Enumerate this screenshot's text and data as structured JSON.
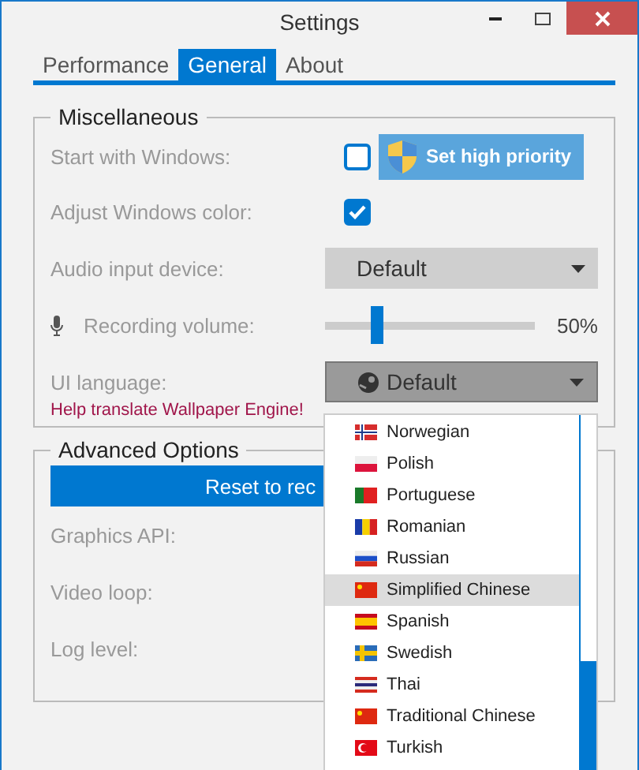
{
  "window": {
    "title": "Settings"
  },
  "tabs": [
    {
      "label": "Performance",
      "selected": false
    },
    {
      "label": "General",
      "selected": true
    },
    {
      "label": "About",
      "selected": false
    }
  ],
  "miscellaneous": {
    "title": "Miscellaneous",
    "start_with_windows": {
      "label": "Start with Windows:",
      "checked": false,
      "button": "Set high priority"
    },
    "adjust_windows_color": {
      "label": "Adjust Windows color:",
      "checked": true
    },
    "audio_input_device": {
      "label": "Audio input device:",
      "value": "Default"
    },
    "recording_volume": {
      "label": "Recording volume:",
      "level": 0.25,
      "reading": "50%"
    },
    "ui_language": {
      "label": "UI language:",
      "value": "Default",
      "expanded": true,
      "help_link": "Help translate Wallpaper Engine!"
    }
  },
  "advanced_options": {
    "title": "Advanced Options",
    "reset_button": "Reset to rec",
    "rows": [
      {
        "label": "Graphics API:"
      },
      {
        "label": "Video loop:"
      },
      {
        "label": "Log level:"
      }
    ]
  },
  "language_menu": [
    {
      "label": "Norwegian",
      "selected": false,
      "kind": "norway"
    },
    {
      "label": "Polish",
      "selected": false,
      "kind": "poland"
    },
    {
      "label": "Portuguese",
      "selected": false,
      "kind": "portugal"
    },
    {
      "label": "Romanian",
      "selected": false,
      "kind": "romania"
    },
    {
      "label": "Russian",
      "selected": false,
      "kind": "russia"
    },
    {
      "label": "Simplified Chinese",
      "selected": true,
      "kind": "china"
    },
    {
      "label": "Spanish",
      "selected": false,
      "kind": "spain"
    },
    {
      "label": "Swedish",
      "selected": false,
      "kind": "sweden"
    },
    {
      "label": "Thai",
      "selected": false,
      "kind": "thailand"
    },
    {
      "label": "Traditional Chinese",
      "selected": false,
      "kind": "china"
    },
    {
      "label": "Turkish",
      "selected": false,
      "kind": "turkey"
    }
  ]
}
